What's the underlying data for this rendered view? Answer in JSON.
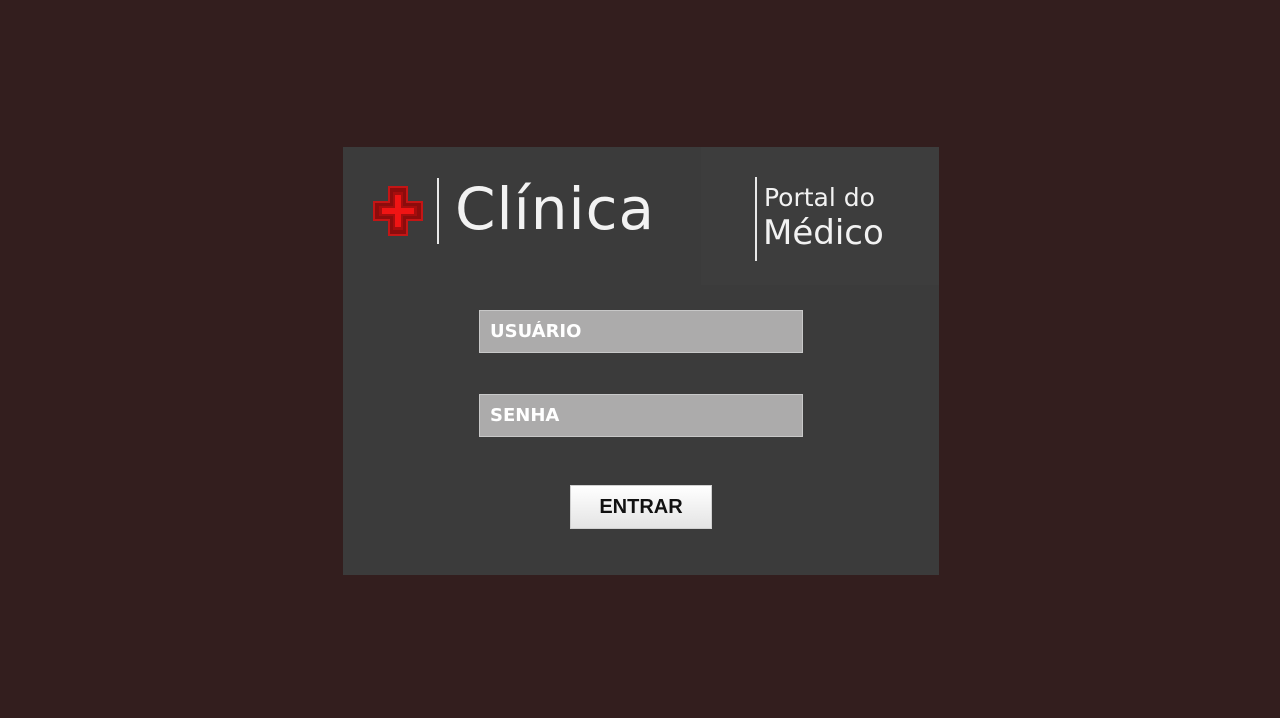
{
  "background_color": "#331e1e",
  "panel_color": "#3b3b3b",
  "accent_color": "#d10a0a",
  "brand": {
    "logo_icon": "medical-cross-icon",
    "clinic_name": "Clínica",
    "portal_line1": "Portal do",
    "portal_line2": "Médico"
  },
  "form": {
    "username_placeholder": "USUÁRIO",
    "password_placeholder": "SENHA",
    "submit_label": "ENTRAR"
  }
}
